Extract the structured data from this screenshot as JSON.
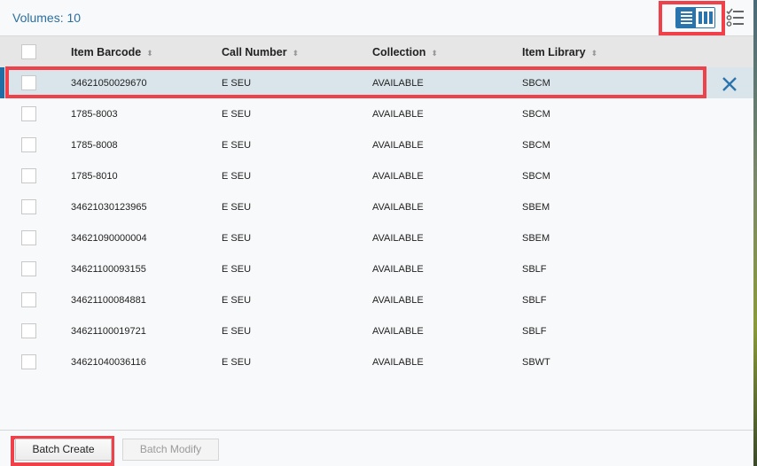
{
  "header": {
    "volumes_label": "Volumes: 10",
    "view_toggle": {
      "active": "list",
      "options": [
        "list-icon",
        "columns-icon"
      ]
    },
    "settings_icon": "column-settings-icon"
  },
  "table": {
    "columns": [
      {
        "label": "Item Barcode",
        "sortable": true
      },
      {
        "label": "Call Number",
        "sortable": true
      },
      {
        "label": "Collection",
        "sortable": true
      },
      {
        "label": "Item Library",
        "sortable": true
      }
    ],
    "sort_glyph": "⬍",
    "rows": [
      {
        "barcode": "34621050029670",
        "call_number": "E SEU",
        "collection": "AVAILABLE",
        "library": "SBCM",
        "selected": true
      },
      {
        "barcode": "1785-8003",
        "call_number": "E SEU",
        "collection": "AVAILABLE",
        "library": "SBCM"
      },
      {
        "barcode": "1785-8008",
        "call_number": "E SEU",
        "collection": "AVAILABLE",
        "library": "SBCM"
      },
      {
        "barcode": "1785-8010",
        "call_number": "E SEU",
        "collection": "AVAILABLE",
        "library": "SBCM"
      },
      {
        "barcode": "34621030123965",
        "call_number": "E SEU",
        "collection": "AVAILABLE",
        "library": "SBEM"
      },
      {
        "barcode": "34621090000004",
        "call_number": "E SEU",
        "collection": "AVAILABLE",
        "library": "SBEM"
      },
      {
        "barcode": "34621100093155",
        "call_number": "E SEU",
        "collection": "AVAILABLE",
        "library": "SBLF"
      },
      {
        "barcode": "34621100084881",
        "call_number": "E SEU",
        "collection": "AVAILABLE",
        "library": "SBLF"
      },
      {
        "barcode": "34621100019721",
        "call_number": "E SEU",
        "collection": "AVAILABLE",
        "library": "SBLF"
      },
      {
        "barcode": "34621040036116",
        "call_number": "E SEU",
        "collection": "AVAILABLE",
        "library": "SBWT"
      }
    ]
  },
  "footer": {
    "batch_create_label": "Batch Create",
    "batch_modify_label": "Batch Modify",
    "batch_modify_disabled": true
  },
  "colors": {
    "accent": "#2a74ad",
    "selected_row": "#dae5eb",
    "highlight_outline": "#f0414a"
  }
}
